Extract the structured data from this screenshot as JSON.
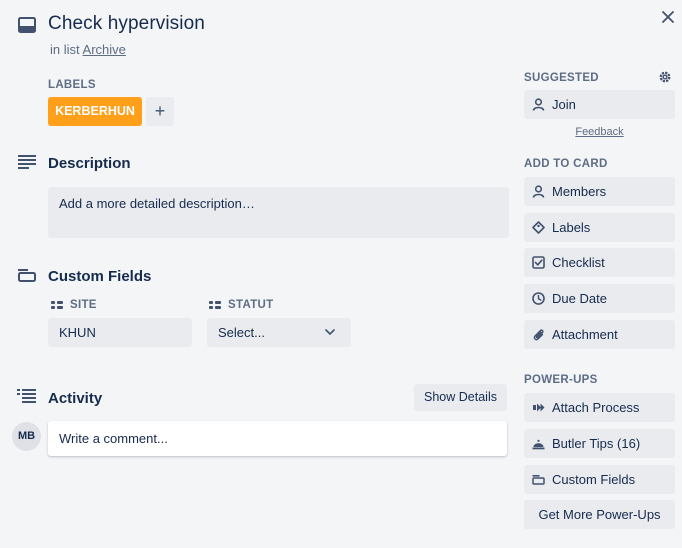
{
  "card": {
    "title": "Check hypervision",
    "in_list_prefix": "in list",
    "list_name": "Archive"
  },
  "labels": {
    "heading": "LABELS",
    "items": [
      {
        "text": "KERBERHUN",
        "color": "#ff9f1a"
      }
    ],
    "add_symbol": "+"
  },
  "description": {
    "heading": "Description",
    "placeholder": "Add a more detailed description…"
  },
  "custom_fields": {
    "heading": "Custom Fields",
    "fields": [
      {
        "label": "SITE",
        "value": "KHUN"
      },
      {
        "label": "STATUT",
        "value": "Select..."
      }
    ]
  },
  "activity": {
    "heading": "Activity",
    "show_details": "Show Details",
    "avatar_initials": "MB",
    "comment_placeholder": "Write a comment..."
  },
  "sidebar": {
    "suggested": {
      "heading": "SUGGESTED",
      "join": "Join",
      "feedback": "Feedback"
    },
    "add_to_card": {
      "heading": "ADD TO CARD",
      "items": [
        "Members",
        "Labels",
        "Checklist",
        "Due Date",
        "Attachment"
      ]
    },
    "power_ups": {
      "heading": "POWER-UPS",
      "items": [
        "Attach Process",
        "Butler Tips (16)",
        "Custom Fields"
      ],
      "more": "Get More Power-Ups"
    }
  },
  "icons": [
    "card-icon",
    "close-icon",
    "description-icon",
    "custom-fields-icon",
    "activity-icon",
    "gear-icon",
    "person-icon",
    "tag-icon",
    "checklist-icon",
    "clock-icon",
    "paperclip-icon",
    "attach-process-icon",
    "butler-icon",
    "field-icon",
    "chevron-down-icon"
  ]
}
